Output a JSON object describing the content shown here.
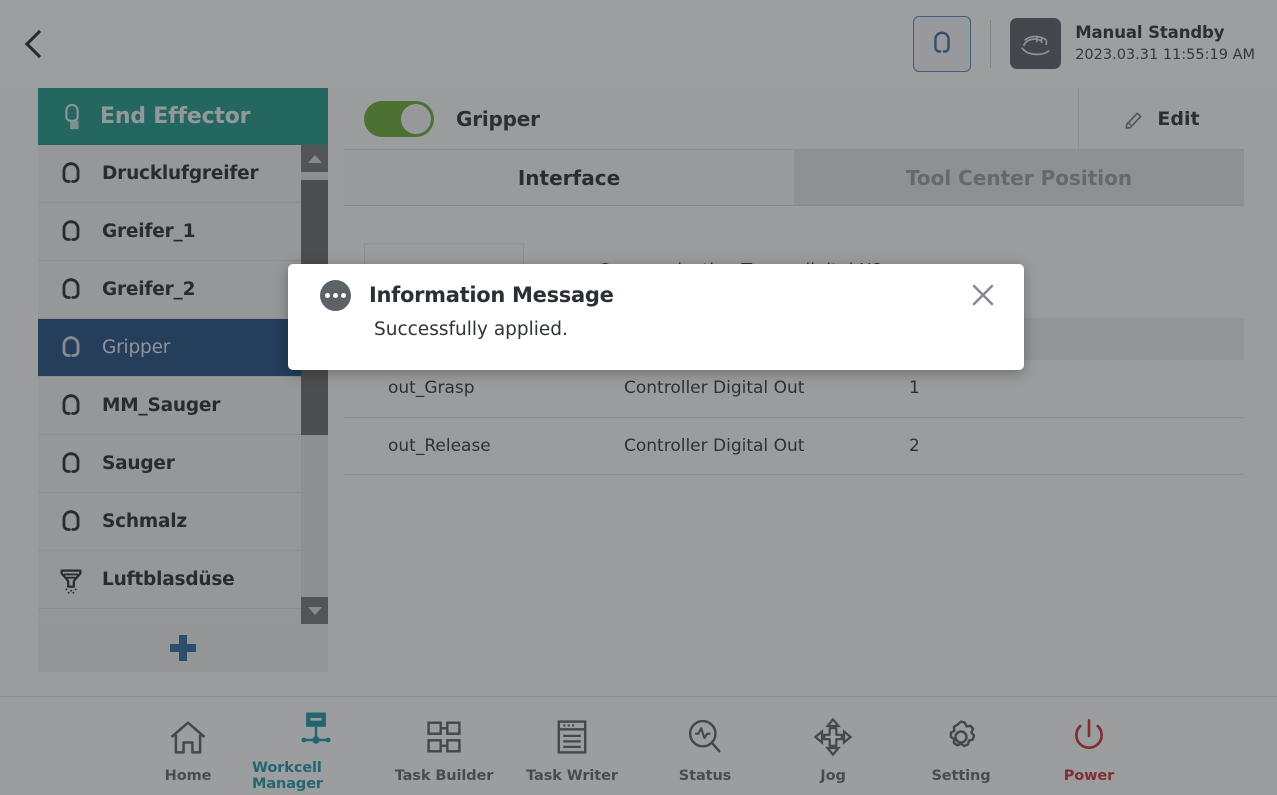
{
  "header": {
    "back_icon": "chevron-left-icon",
    "end_effector_icon": "gripper-icon",
    "mode_icon": "manual-hand-icon",
    "status_title": "Manual Standby",
    "status_time": "2023.03.31 11:55:19 AM"
  },
  "sidebar": {
    "title": "End Effector",
    "title_icon": "end-effector-icon",
    "add_label": "+",
    "items": [
      {
        "label": "Drucklufgreifer",
        "icon": "gripper-icon",
        "selected": false
      },
      {
        "label": "Greifer_1",
        "icon": "gripper-icon",
        "selected": false
      },
      {
        "label": "Greifer_2",
        "icon": "gripper-icon",
        "selected": false
      },
      {
        "label": "Gripper",
        "icon": "gripper-icon",
        "selected": true
      },
      {
        "label": "MM_Sauger",
        "icon": "gripper-icon",
        "selected": false
      },
      {
        "label": "Sauger",
        "icon": "gripper-icon",
        "selected": false
      },
      {
        "label": "Schmalz",
        "icon": "gripper-icon",
        "selected": false
      },
      {
        "label": "Luftblasdüse",
        "icon": "air-nozzle-icon",
        "selected": false
      }
    ]
  },
  "main": {
    "toggle_on": true,
    "device_name": "Gripper",
    "edit_label": "Edit",
    "edit_icon": "pencil-icon",
    "tabs": [
      {
        "label": "Interface",
        "active": true
      },
      {
        "label": "Tool Center Position",
        "active": false
      }
    ],
    "communication_type": "Communication Type - digital I/O",
    "table": {
      "columns": [
        "",
        "",
        ""
      ],
      "rows": [
        {
          "name": "out_Grasp",
          "type": "Controller Digital Out",
          "value": "1"
        },
        {
          "name": "out_Release",
          "type": "Controller Digital Out",
          "value": "2"
        }
      ]
    }
  },
  "dialog": {
    "badge_icon": "info-dots-icon",
    "title": "Information Message",
    "message": "Successfully applied.",
    "close_icon": "close-icon"
  },
  "bottomnav": {
    "left": [
      {
        "label": "Home",
        "icon": "home-icon",
        "active": false
      },
      {
        "label": "Workcell Manager",
        "icon": "workcell-icon",
        "active": true
      },
      {
        "label": "Task Builder",
        "icon": "task-builder-icon",
        "active": false
      },
      {
        "label": "Task Writer",
        "icon": "task-writer-icon",
        "active": false
      }
    ],
    "right": [
      {
        "label": "Status",
        "icon": "status-icon",
        "active": false
      },
      {
        "label": "Jog",
        "icon": "jog-icon",
        "active": false
      },
      {
        "label": "Setting",
        "icon": "gear-icon",
        "active": false
      },
      {
        "label": "Power",
        "icon": "power-icon",
        "active": false,
        "danger": true
      }
    ]
  },
  "colors": {
    "accent_teal": "#0c8f7e",
    "selected_blue": "#0d3f75",
    "toggle_green": "#5fa522",
    "nav_active": "#0b8fa0",
    "power_red": "#c02026"
  }
}
